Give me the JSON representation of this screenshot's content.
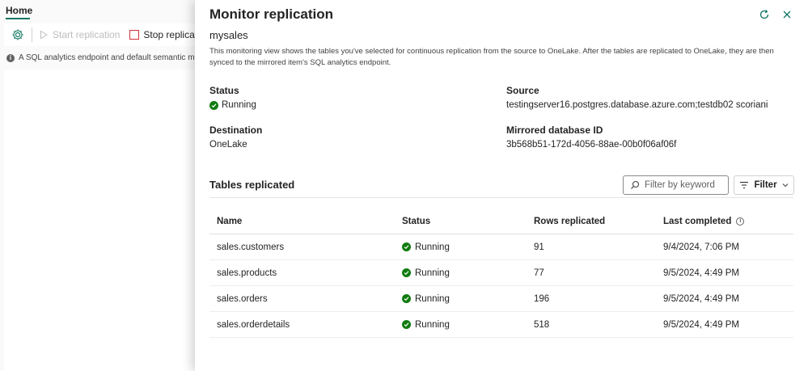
{
  "background": {
    "tab_home": "Home",
    "toolbar": {
      "start_replication": "Start replication",
      "stop_replication": "Stop replication"
    },
    "info_text": "A SQL analytics endpoint and default semantic model w"
  },
  "panel": {
    "title": "Monitor replication",
    "database_name": "mysales",
    "description": "This monitoring view shows the tables you've selected for continuous replication from the source to OneLake. After the tables are replicated to OneLake, they are then synced to the mirrored item's SQL analytics endpoint.",
    "status_label": "Status",
    "status_value": "Running",
    "source_label": "Source",
    "source_value": "testingserver16.postgres.database.azure.com;testdb02 scoriani",
    "destination_label": "Destination",
    "destination_value": "OneLake",
    "mirrored_db_label": "Mirrored database ID",
    "mirrored_db_value": "3b568b51-172d-4056-88ae-00b0f06af06f",
    "tables_title": "Tables replicated",
    "filter_placeholder": "Filter by keyword",
    "filter_button": "Filter"
  },
  "table": {
    "headers": {
      "name": "Name",
      "status": "Status",
      "rows": "Rows replicated",
      "last_completed": "Last completed"
    },
    "rows": [
      {
        "name": "sales.customers",
        "status": "Running",
        "rows": "91",
        "last_completed": "9/4/2024, 7:06 PM"
      },
      {
        "name": "sales.products",
        "status": "Running",
        "rows": "77",
        "last_completed": "9/5/2024, 4:49 PM"
      },
      {
        "name": "sales.orders",
        "status": "Running",
        "rows": "196",
        "last_completed": "9/5/2024, 4:49 PM"
      },
      {
        "name": "sales.orderdetails",
        "status": "Running",
        "rows": "518",
        "last_completed": "9/5/2024, 4:49 PM"
      }
    ]
  },
  "colors": {
    "accent": "#117865",
    "success": "#107c10",
    "stop": "#d13438"
  }
}
